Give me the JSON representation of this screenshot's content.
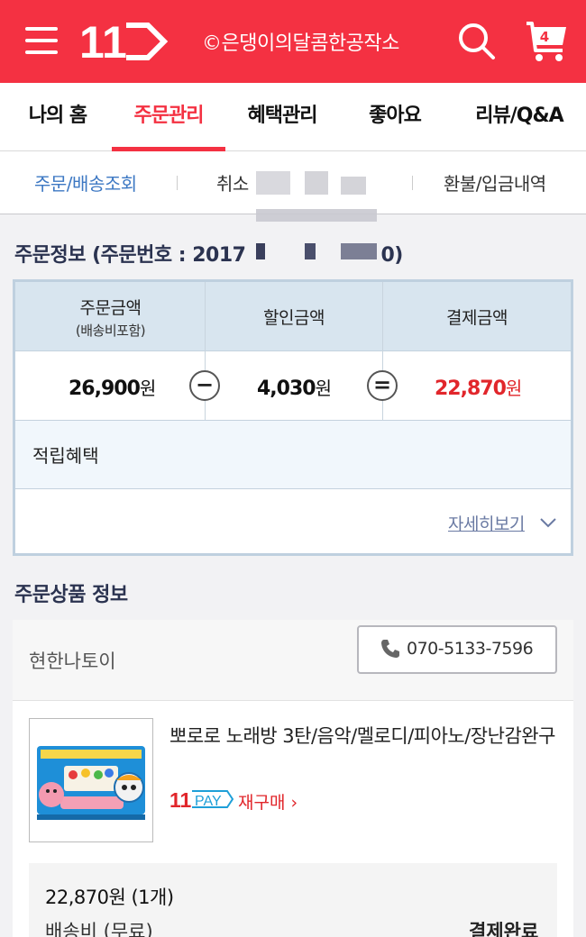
{
  "header": {
    "store_name": "©은댕이의달콤한공작소",
    "logo_text": "11",
    "cart_count": "4",
    "colors": {
      "brand": "#f43142",
      "link": "#3d78c3",
      "price": "#e1262b"
    }
  },
  "main_tabs": [
    {
      "label": "나의 홈"
    },
    {
      "label": "주문관리",
      "active": true
    },
    {
      "label": "혜택관리"
    },
    {
      "label": "좋아요"
    },
    {
      "label": "리뷰/Q&A"
    }
  ],
  "sub_tabs": [
    {
      "label": "주문/배송조회",
      "active": true
    },
    {
      "label": "취소"
    },
    {
      "label": "환불/입금내역"
    }
  ],
  "order_info": {
    "title": "주문정보 (주문번호 : 2017",
    "title_end": "0)",
    "col_order_amount": "주문금액",
    "col_order_amount_sub": "(배송비포함)",
    "col_discount": "할인금액",
    "col_payment": "결제금액",
    "order_amount": "26,900",
    "discount": "4,030",
    "payment": "22,870",
    "currency": "원",
    "minus": "−",
    "equals": "=",
    "reward_label": "적립혜택",
    "detail_link": "자세히보기"
  },
  "product_section": {
    "title": "주문상품 정보",
    "seller": "현한나토이",
    "phone": "070-5133-7596",
    "product_name": "뽀로로 노래방 3탄/음악/멜로디/피아노/장난감완구",
    "pay_brand": "11",
    "pay_word": "PAY",
    "repurchase": "재구매",
    "price_line": "22,870원 (1개)",
    "shipping": "배송비 (무료)",
    "status": "결제완료"
  }
}
